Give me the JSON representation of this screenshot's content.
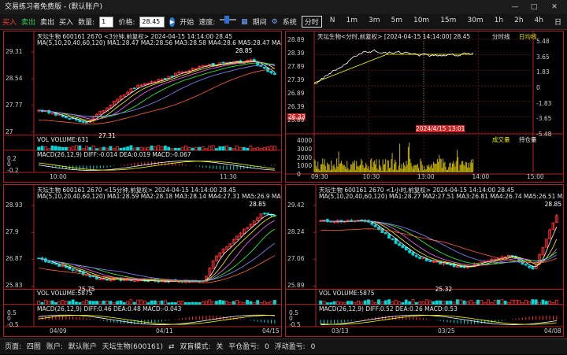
{
  "app": {
    "title": "交易练习者免费版 - (默认账户)"
  },
  "window_controls": {
    "minimize": "—",
    "maximize": "□",
    "close": "✕"
  },
  "toolbar": {
    "buy_label": "买入",
    "sell_label": "卖出",
    "short_sell_label": "卖出",
    "short_buy_label": "买入",
    "qty_label": "数量:",
    "qty_value": "1",
    "price_label": "价格:",
    "price_value": "28.45",
    "start_label": "开始",
    "speed_label": "速度:",
    "period_label": "期间",
    "system_label": "系统",
    "periods": [
      "分时",
      "N",
      "1m",
      "3m",
      "5m",
      "10m",
      "15m",
      "30m",
      "1h",
      "2h",
      "4h",
      "日"
    ],
    "active_period": "分时"
  },
  "panels": {
    "p3m": {
      "header": "天坛生物 600161  2670 <3分钟,前复权>  2024-04-15 14:14:00  28.45",
      "ma_line": "MA(5,10,20,40,60,120)  MA1:28.47 MA2:28.56 MA3:28.58 MA4:28.6 MA5:28.47 MA6:27.96",
      "yticks": [
        "29.31",
        "28.54",
        "27.77",
        "27"
      ],
      "xticks": [
        "10:00",
        "11:30"
      ],
      "hi": "28.85",
      "lo": "27.31",
      "vol_label": "VOL  VOLUME:631",
      "macd_label": "MACD(26,12,9)  DIFF:-0.014 DEA:0.019 MACD:-0.067",
      "macd_ticks": [
        "0.2",
        "0",
        "-0.2"
      ]
    },
    "ptime": {
      "header": "天坛生物<分时,前复权>    [2024-04-15 14:14:00]    28.45",
      "tag1": "分时线",
      "tag2": "日均线",
      "yticks_left": [
        "28.89",
        "28.39",
        "27.89",
        "27.39",
        "26.89",
        "26.39",
        "26.33",
        "25.89"
      ],
      "yticks_right": [
        "5.48",
        "3.65",
        "1.83",
        "0",
        "-1.83",
        "-3.65",
        "-5.48"
      ],
      "vol_ticks": [
        "4000",
        "3000",
        "2000",
        "1000",
        "0"
      ],
      "vol_tag1": "成交量",
      "vol_tag2": "持仓量",
      "xticks": [
        "09:30",
        "10:30",
        "13:00",
        "14:00",
        "15:00"
      ],
      "cursor_label": "2024/4/15 13:01",
      "price_tag": "26.33"
    },
    "p15m": {
      "header": "天坛生物 600161  2670 <15分钟,前复权>  2024-04-15 14:14:00  28.45",
      "ma_line": "MA(5,10,20,40,60,120)  MA1:28.59 MA2:28.18 MA3:28.14 MA4:27.31 MA5:26.9 MA6:26.71",
      "yticks": [
        "28.93",
        "27.9",
        "26.87",
        "25.83"
      ],
      "xticks": [
        "04/09",
        "04/11",
        "04/15"
      ],
      "hi": "28.85",
      "lo": "25.75",
      "vol_label": "VOL  VOLUME:5875",
      "macd_label": "MACD(26,12,9)  DIFF:0.46 DEA:0.48 MACD:-0.043",
      "macd_ticks": [
        "0.5",
        "0",
        "-0.5"
      ]
    },
    "p1h": {
      "header": "天坛生物 600161  2670 <1小时,前复权>  2024-04-15 14:14:00  28.45",
      "ma_line": "MA(5,10,20,40,60,120)  MA1:28.27 MA2:27.51 MA3:26.81 MA4:26.74 MA5:26.51 MA6:27.15",
      "yticks": [
        "29.42",
        "28.24",
        "27.06",
        "25.89"
      ],
      "xticks": [
        "03/13",
        "03/25",
        "04/08"
      ],
      "hi": "28.85",
      "lo": "25.32",
      "vol_label": "VOL  VOLUME:5875",
      "macd_label": "MACD(26,12,9)  DIFF:0.52 DEA:0.26 MACD:0.53",
      "macd_ticks": [
        "0.5",
        "0",
        "-0.5"
      ]
    }
  },
  "statusbar": {
    "page_label": "页面:",
    "page_value": "四图",
    "account_label": "账户:",
    "account_value": "默认账户",
    "symbol": "天坛生物(600161)",
    "mode_label": "双盲模式:",
    "mode_value": "关",
    "profit_label": "平仓盈亏:",
    "profit_value": "0",
    "float_label": "浮动盈亏:",
    "float_value": "0"
  }
}
